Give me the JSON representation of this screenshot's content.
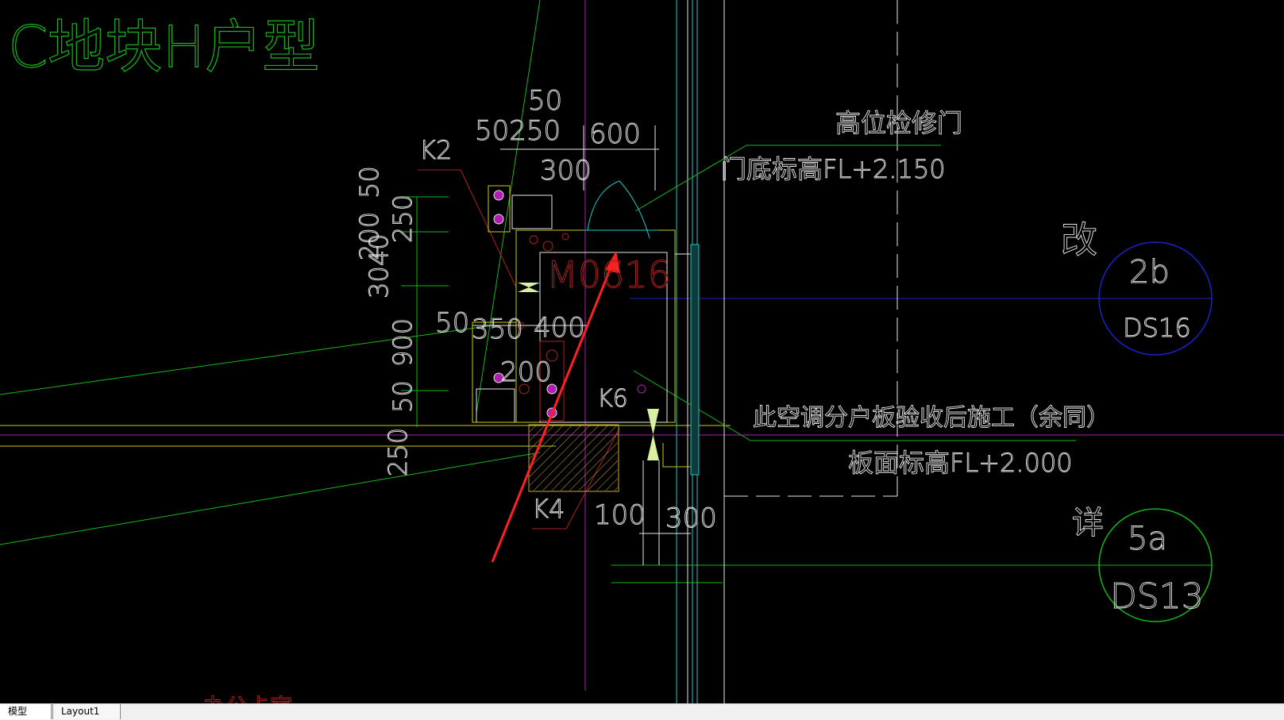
{
  "drawing": {
    "title": "C地块H户型",
    "partial_bottom_text": "办公卡室",
    "labels": {
      "k2": "K2",
      "k4": "K4",
      "k6": "K6",
      "door_code": "M0616",
      "annotation_1": "高位检修门",
      "annotation_2": "门底标高FL+2.150",
      "annotation_3": "此空调分户板验收后施工（余同）",
      "annotation_4": "板面标高FL+2.000",
      "change_mark": "改",
      "detail_mark": "详"
    },
    "dimensions": {
      "d50_top": "50",
      "d50_250": "50250",
      "d600": "600",
      "d300_top": "300",
      "v50_top": "50",
      "v250": "250",
      "v200": "200",
      "v3040": "3040",
      "v900": "900",
      "v50_bottom": "50",
      "v250_bottom": "250",
      "h50_350": "50",
      "h350": "350",
      "h400": "400",
      "h200": "200",
      "h100": "100",
      "h300_bottom": "300"
    },
    "callouts": [
      {
        "top": "2b",
        "bottom": "DS16",
        "color": "#1a24c8"
      },
      {
        "top": "5a",
        "bottom": "DS13",
        "color": "#12b812"
      }
    ],
    "colors": {
      "green": "#16b81a",
      "white": "#e6e6e6",
      "yellow": "#c8c822",
      "magenta": "#b01fb0",
      "cyan": "#1ec8c8",
      "blue": "#1a24c8",
      "red": "#ff2020",
      "hatch": "#c8a832"
    }
  },
  "tabs": {
    "model": "模型",
    "layout1": "Layout1"
  }
}
